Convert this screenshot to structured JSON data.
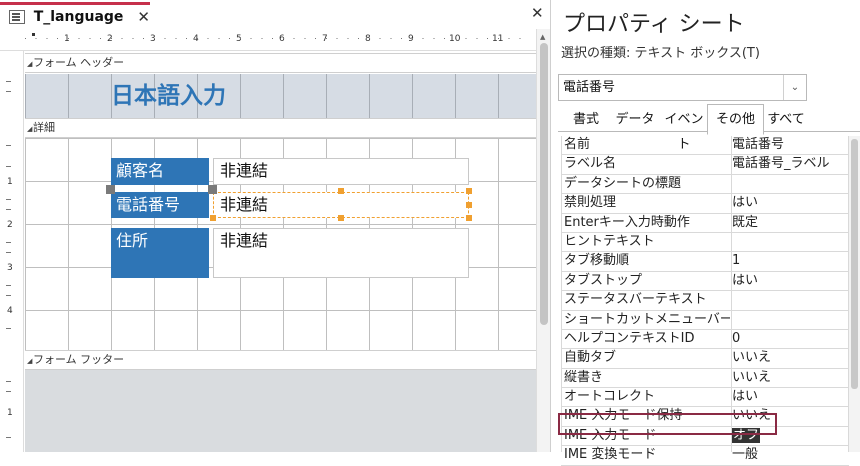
{
  "designer": {
    "tab_label": "T_language",
    "tab_close": "✕",
    "pane_close": "✕",
    "ruler_h": [
      "1",
      "2",
      "3",
      "4",
      "5",
      "6",
      "7",
      "8",
      "9",
      "10",
      "11"
    ],
    "ruler_v_detail": [
      "1",
      "2",
      "3",
      "4"
    ],
    "ruler_v_footer": [
      "1"
    ],
    "sections": {
      "header": "フォーム ヘッダー",
      "detail": "詳細",
      "footer": "フォーム フッター"
    },
    "title_label": "日本語入力",
    "fields": [
      {
        "label": "顧客名",
        "value": "非連結"
      },
      {
        "label": "電話番号",
        "value": "非連結"
      },
      {
        "label": "住所",
        "value": "非連結"
      }
    ]
  },
  "property_sheet": {
    "title": "プロパティ シート",
    "selection_type": "選択の種類: テキスト ボックス(T)",
    "selected_control": "電話番号",
    "tabs": [
      "書式",
      "データ",
      "イベント",
      "その他",
      "すべて"
    ],
    "active_tab": "その他",
    "rows": [
      {
        "name": "名前",
        "value": "電話番号"
      },
      {
        "name": "ラベル名",
        "value": "電話番号_ラベル"
      },
      {
        "name": "データシートの標題",
        "value": ""
      },
      {
        "name": "禁則処理",
        "value": "はい"
      },
      {
        "name": "Enterキー入力時動作",
        "value": "既定"
      },
      {
        "name": "ヒントテキスト",
        "value": ""
      },
      {
        "name": "タブ移動順",
        "value": "1"
      },
      {
        "name": "タブストップ",
        "value": "はい"
      },
      {
        "name": "ステータスバーテキスト",
        "value": ""
      },
      {
        "name": "ショートカットメニューバー",
        "value": ""
      },
      {
        "name": "ヘルプコンテキストID",
        "value": "0"
      },
      {
        "name": "自動タブ",
        "value": "いいえ"
      },
      {
        "name": "縦書き",
        "value": "いいえ"
      },
      {
        "name": "オートコレクト",
        "value": "はい"
      },
      {
        "name": "IME 入力モード保持",
        "value": "いいえ"
      },
      {
        "name": "IME 入力モード",
        "value": "オフ"
      },
      {
        "name": "IME 変換モード",
        "value": "一般"
      }
    ]
  },
  "colors": {
    "label_bg": "#2e75b6",
    "title_text": "#2e75b6",
    "selection_handle": "#f0a030",
    "highlight_border": "#8a2a44",
    "tab_accent": "#c6304b"
  }
}
